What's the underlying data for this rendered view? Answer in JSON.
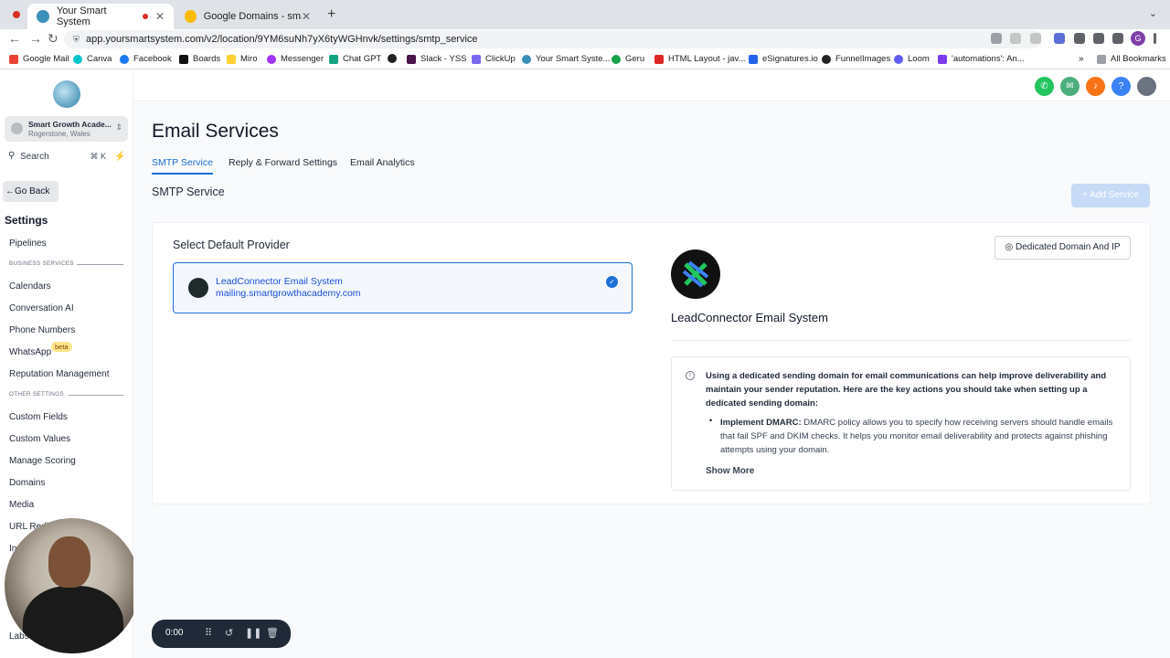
{
  "browser": {
    "tabs": [
      {
        "title": "Your Smart System",
        "active": true
      },
      {
        "title": "Google Domains - smartgrowt",
        "active": false
      }
    ],
    "url": "app.yoursmartsystem.com/v2/location/9YM6suNh7yX6tyWGHnvk/settings/smtp_service",
    "bookmarks": [
      "Google Mail",
      "Canva",
      "Facebook",
      "Boards",
      "Miro",
      "Messenger",
      "Chat GPT",
      "Slack - YSS",
      "ClickUp",
      "Your Smart Syste...",
      "Geru",
      "HTML Layout - jav...",
      "eSignatures.io",
      "FunnelImages",
      "Loom",
      "'automations': An...",
      "All Bookmarks"
    ],
    "profile_initial": "G"
  },
  "sidebar": {
    "account_name": "Smart Growth Acade...",
    "account_location": "Rogerstone, Wales",
    "search_label": "Search",
    "search_shortcut": "⌘ K",
    "go_back": "Go Back",
    "settings_title": "Settings",
    "items": [
      "Pipelines",
      "Calendars",
      "Conversation AI",
      "Phone Numbers",
      "WhatsApp",
      "Reputation Management",
      "Custom Fields",
      "Custom Values",
      "Manage Scoring",
      "Domains",
      "Media",
      "URL Redi",
      "In",
      "Labs"
    ],
    "section_business": "BUSINESS SERVICES",
    "section_other": "OTHER SETTINGS",
    "beta_badge": "beta"
  },
  "main": {
    "page_title": "Email Services",
    "tabs": [
      "SMTP Service",
      "Reply & Forward Settings",
      "Email Analytics"
    ],
    "subtitle": "SMTP Service",
    "add_service": "Add Service",
    "select_default_provider": "Select Default Provider",
    "provider": {
      "name": "LeadConnector Email System",
      "domain": "mailing.smartgrowthacademy.com"
    },
    "dedicated_button": "Dedicated Domain And IP",
    "provider_title": "LeadConnector Email System",
    "info_intro": "Using a dedicated sending domain for email communications can help improve deliverability and maintain your sender reputation. Here are the key actions you should take when setting up a dedicated sending domain:",
    "bullet_title": "Implement DMARC:",
    "bullet_text": " DMARC policy allows you to specify how receiving servers should handle emails that fail SPF and DKIM checks. It helps you monitor email deliverability and protects against phishing attempts using your domain.",
    "show_more": "Show More"
  },
  "recorder": {
    "time": "0:00"
  }
}
